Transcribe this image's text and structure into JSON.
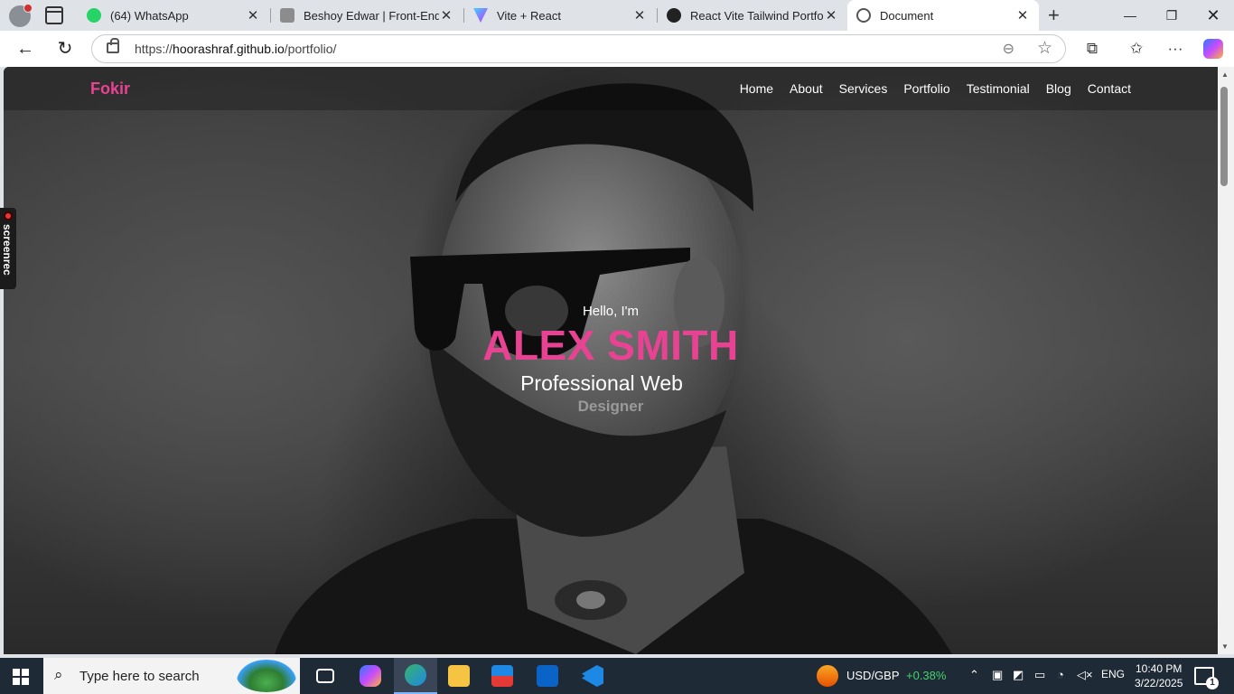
{
  "browser": {
    "tabs": [
      {
        "title": "(64) WhatsApp",
        "favicon": "whatsapp-icon",
        "color": "#25d366"
      },
      {
        "title": "Beshoy Edwar | Front-End Web",
        "favicon": "site-favicon",
        "color": "#8c8c8c"
      },
      {
        "title": "Vite + React",
        "favicon": "vite-icon",
        "color": "#8f5cff"
      },
      {
        "title": "React Vite Tailwind Portfolio",
        "favicon": "github-icon",
        "color": "#222222"
      },
      {
        "title": "Document",
        "favicon": "globe-icon",
        "color": "#555555",
        "active": true
      }
    ],
    "url": {
      "scheme": "https://",
      "host": "hoorashraf.github.io",
      "path": "/portfolio/"
    }
  },
  "site": {
    "logo": "Fokir",
    "nav": [
      "Home",
      "About",
      "Services",
      "Portfolio",
      "Testimonial",
      "Blog",
      "Contact"
    ],
    "hero": {
      "greeting": "Hello, I'm",
      "name": "ALEX SMITH",
      "role_line1": "Professional Web",
      "role_line2": "Designer"
    },
    "accent": "#e84393"
  },
  "overlay": {
    "screenrec": "screenrec"
  },
  "taskbar": {
    "search_placeholder": "Type here to search",
    "ticker_label": "USD/GBP",
    "ticker_change": "+0.38%",
    "language": "ENG",
    "time": "10:40 PM",
    "date": "3/22/2025",
    "notifications": "1"
  }
}
